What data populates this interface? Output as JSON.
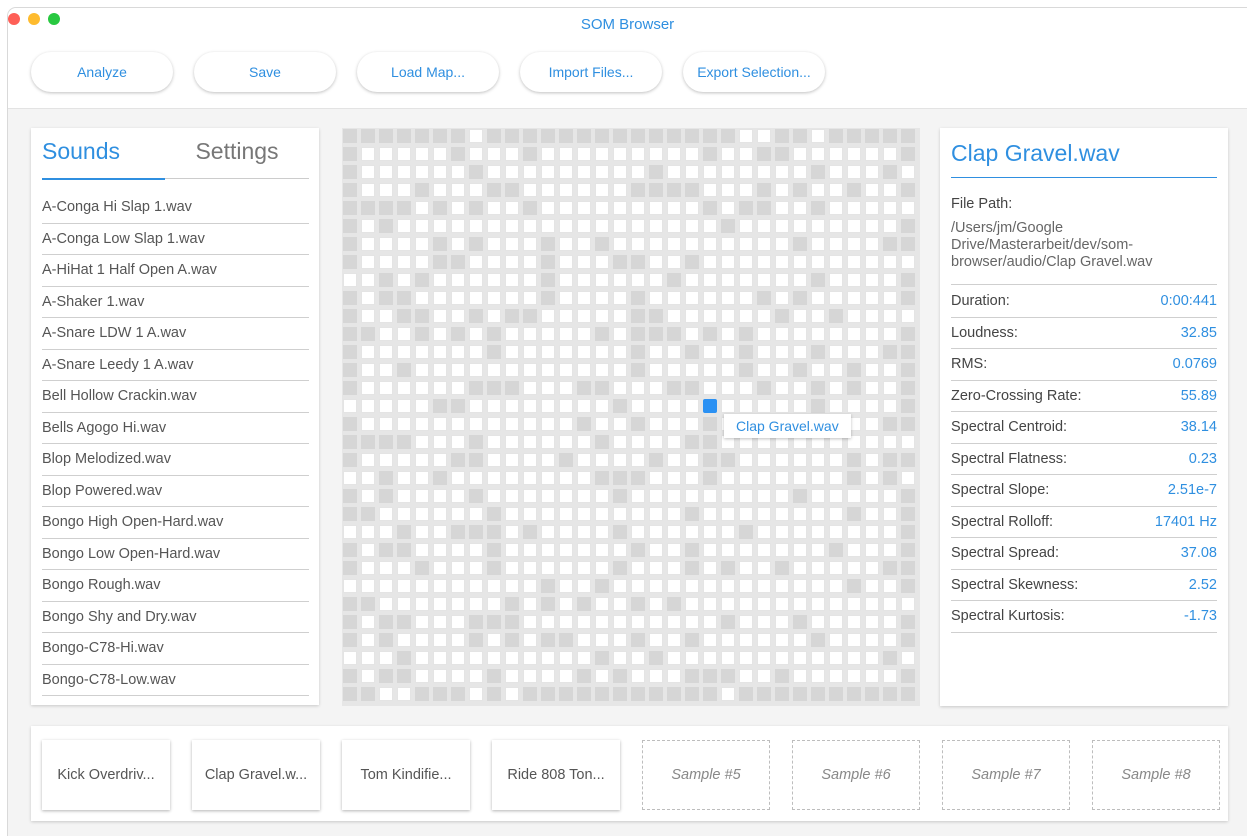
{
  "window": {
    "title": "SOM Browser"
  },
  "toolbar": {
    "analyze": "Analyze",
    "save": "Save",
    "load_map": "Load Map...",
    "import_files": "Import Files...",
    "export_selection": "Export Selection..."
  },
  "sidebar": {
    "tabs": {
      "sounds": "Sounds",
      "settings": "Settings"
    },
    "sounds": [
      "A-Conga Hi Slap 1.wav",
      "A-Conga Low Slap 1.wav",
      "A-HiHat 1 Half Open A.wav",
      "A-Shaker 1.wav",
      "A-Snare LDW 1 A.wav",
      "A-Snare Leedy 1 A.wav",
      "Bell Hollow Crackin.wav",
      "Bells Agogo Hi.wav",
      "Blop Melodized.wav",
      "Blop Powered.wav",
      "Bongo High Open-Hard.wav",
      "Bongo Low Open-Hard.wav",
      "Bongo Rough.wav",
      "Bongo Shy and Dry.wav",
      "Bongo-C78-Hi.wav",
      "Bongo-C78-Low.wav"
    ]
  },
  "map": {
    "selected_label": "Clap Gravel.wav",
    "colors": {
      "empty": "#d6d6d6",
      "filled": "#ffffff",
      "selected": "#2b91f3"
    }
  },
  "details": {
    "title": "Clap Gravel.wav",
    "file_path_label": "File Path:",
    "file_path": "/Users/jm/Google Drive/Masterarbeit/dev/som-browser/audio/Clap Gravel.wav",
    "properties": [
      {
        "label": "Duration:",
        "value": "0:00:441"
      },
      {
        "label": "Loudness:",
        "value": "32.85"
      },
      {
        "label": "RMS:",
        "value": "0.0769"
      },
      {
        "label": "Zero-Crossing Rate:",
        "value": "55.89"
      },
      {
        "label": "Spectral Centroid:",
        "value": "38.14"
      },
      {
        "label": "Spectral Flatness:",
        "value": "0.23"
      },
      {
        "label": "Spectral Slope:",
        "value": "2.51e-7"
      },
      {
        "label": "Spectral Rolloff:",
        "value": "17401 Hz"
      },
      {
        "label": "Spectral Spread:",
        "value": "37.08"
      },
      {
        "label": "Spectral Skewness:",
        "value": "2.52"
      },
      {
        "label": "Spectral Kurtosis:",
        "value": "-1.73"
      }
    ]
  },
  "samples": [
    {
      "label": "Kick Overdriv...",
      "filled": true
    },
    {
      "label": "Clap Gravel.w...",
      "filled": true
    },
    {
      "label": "Tom Kindifie...",
      "filled": true
    },
    {
      "label": "Ride 808 Ton...",
      "filled": true
    },
    {
      "label": "Sample #5",
      "filled": false
    },
    {
      "label": "Sample #6",
      "filled": false
    },
    {
      "label": "Sample #7",
      "filled": false
    },
    {
      "label": "Sample #8",
      "filled": false
    }
  ],
  "colors": {
    "accent": "#2f8fe0",
    "background": "#f4f4f4",
    "text": "#555555"
  }
}
